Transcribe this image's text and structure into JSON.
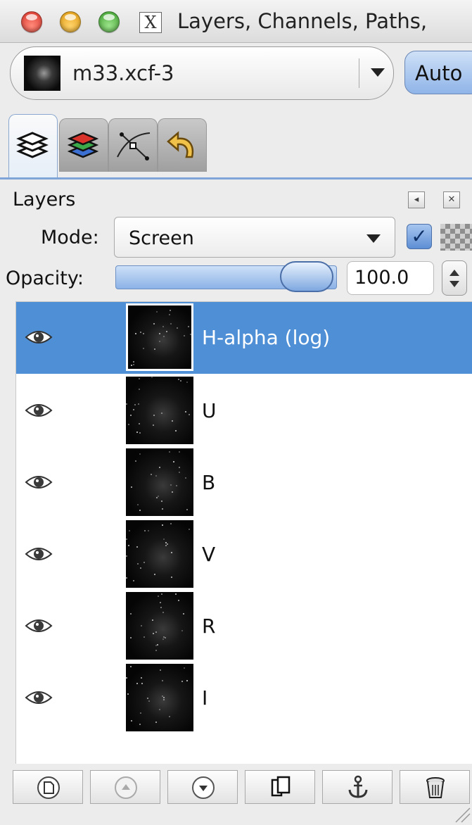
{
  "window": {
    "title": "Layers, Channels, Paths,",
    "x11_glyph": "X"
  },
  "image_selector": {
    "image_name": "m33.xcf-3",
    "auto_label": "Auto"
  },
  "tabs": [
    {
      "name": "layers",
      "icon": "layers-tab-icon",
      "active": true
    },
    {
      "name": "channels",
      "icon": "channels-tab-icon",
      "active": false
    },
    {
      "name": "paths",
      "icon": "paths-tab-icon",
      "active": false
    },
    {
      "name": "undo-history",
      "icon": "undo-tab-icon",
      "active": false
    }
  ],
  "layers_panel": {
    "title": "Layers",
    "mode_label": "Mode:",
    "mode_value": "Screen",
    "keep_transparency_checked": true,
    "opacity_label": "Opacity:",
    "opacity_value": "100.0",
    "opacity_fraction": 1.0
  },
  "layers": [
    {
      "name": "H-alpha (log)",
      "visible": true,
      "selected": true
    },
    {
      "name": "U",
      "visible": true,
      "selected": false
    },
    {
      "name": "B",
      "visible": true,
      "selected": false
    },
    {
      "name": "V",
      "visible": true,
      "selected": false
    },
    {
      "name": "R",
      "visible": true,
      "selected": false
    },
    {
      "name": "I",
      "visible": true,
      "selected": false
    }
  ],
  "bottom_buttons": [
    {
      "name": "new-layer",
      "icon": "new-layer-icon"
    },
    {
      "name": "raise-layer",
      "icon": "raise-layer-icon"
    },
    {
      "name": "lower-layer",
      "icon": "lower-layer-icon"
    },
    {
      "name": "duplicate-layer",
      "icon": "duplicate-layer-icon"
    },
    {
      "name": "anchor-layer",
      "icon": "anchor-icon"
    },
    {
      "name": "delete-layer",
      "icon": "trash-icon"
    }
  ],
  "colors": {
    "selection": "#4f8fd6",
    "accent": "#7fa5d8"
  }
}
